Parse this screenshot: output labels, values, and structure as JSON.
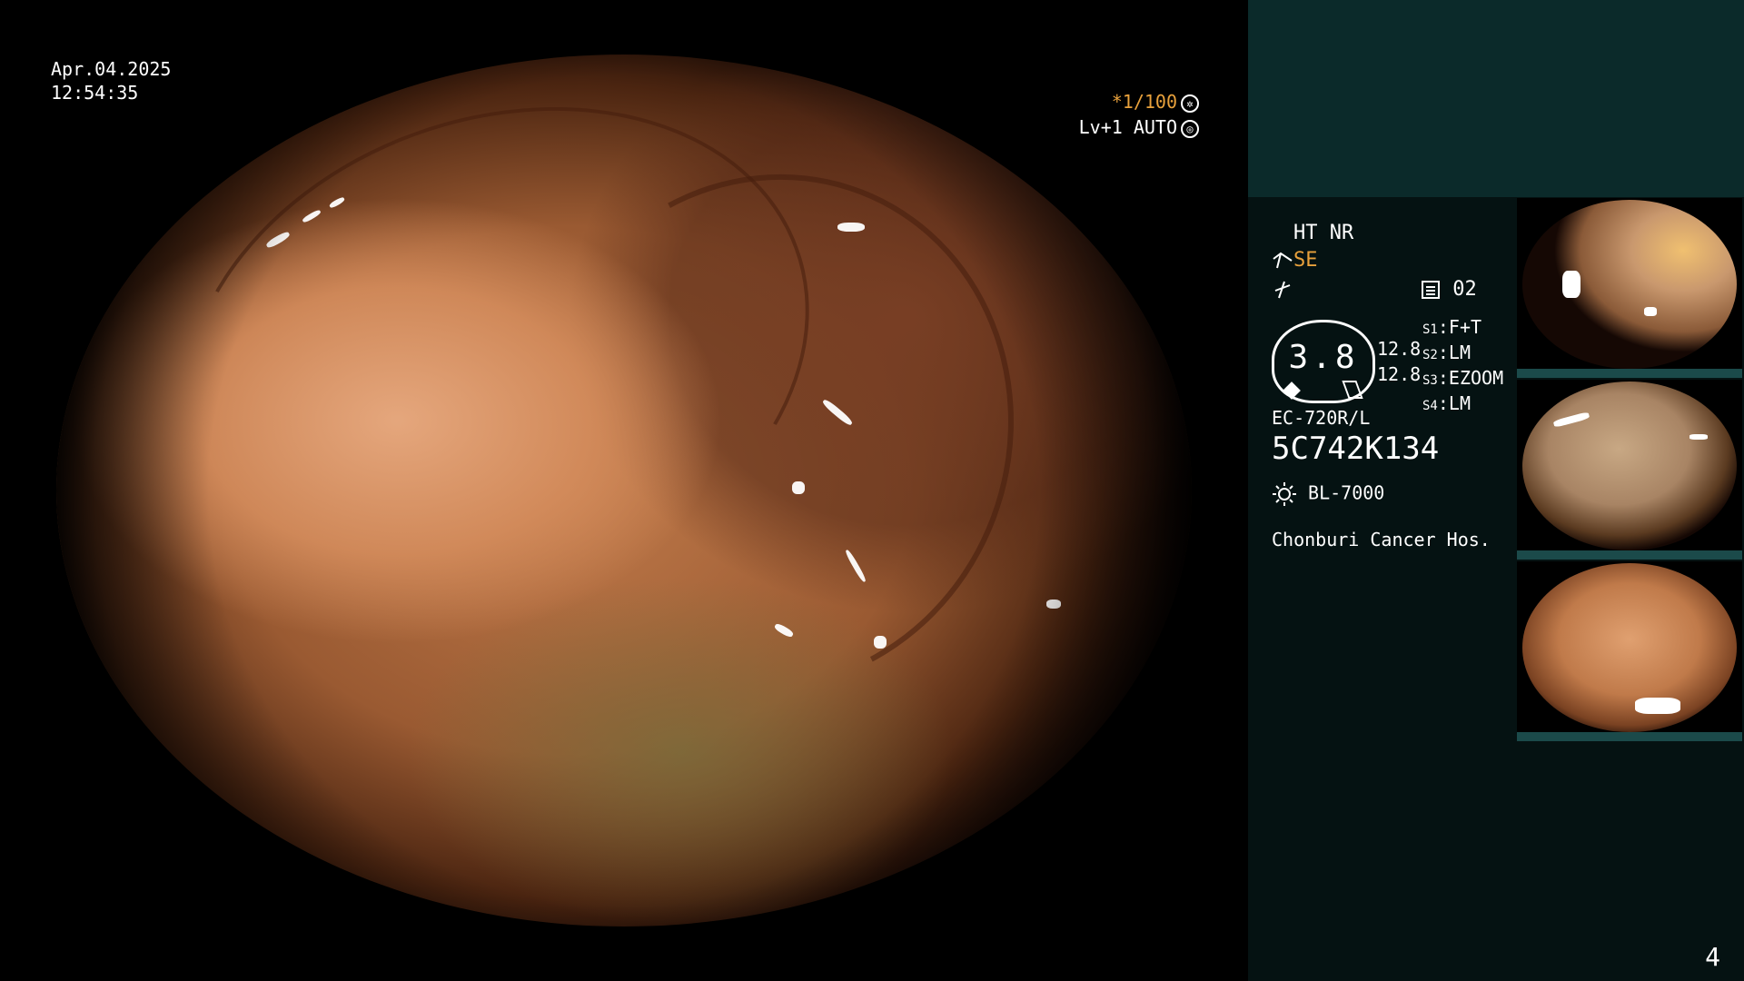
{
  "overlay": {
    "date": "Apr.04.2025",
    "time": "12:54:35",
    "shutter": "*1/100",
    "level": "Lv+1 AUTO"
  },
  "panel": {
    "mode": "HT NR",
    "enhance": "SE",
    "memory_slot": "02",
    "zoom_value": "3.8",
    "zoom_readings": [
      "12.8",
      "12.8"
    ],
    "switches": [
      {
        "key": "S1",
        "value": "F+T"
      },
      {
        "key": "S2",
        "value": "LM"
      },
      {
        "key": "S3",
        "value": "EZOOM"
      },
      {
        "key": "S4",
        "value": "LM"
      }
    ],
    "scope_model": "EC-720R/L",
    "scope_serial": "5C742K134",
    "light_source": "BL-7000",
    "hospital": "Chonburi Cancer Hos."
  },
  "page_number": "4",
  "colors": {
    "orange": "#e8a13c",
    "panel_bg": "#051212",
    "panel_top_bg": "#0b2a2a"
  },
  "icons": [
    "aperture-icon",
    "auto-iris-icon",
    "scope-angle-icon",
    "freeze-icon",
    "memory-icon",
    "light-icon"
  ]
}
